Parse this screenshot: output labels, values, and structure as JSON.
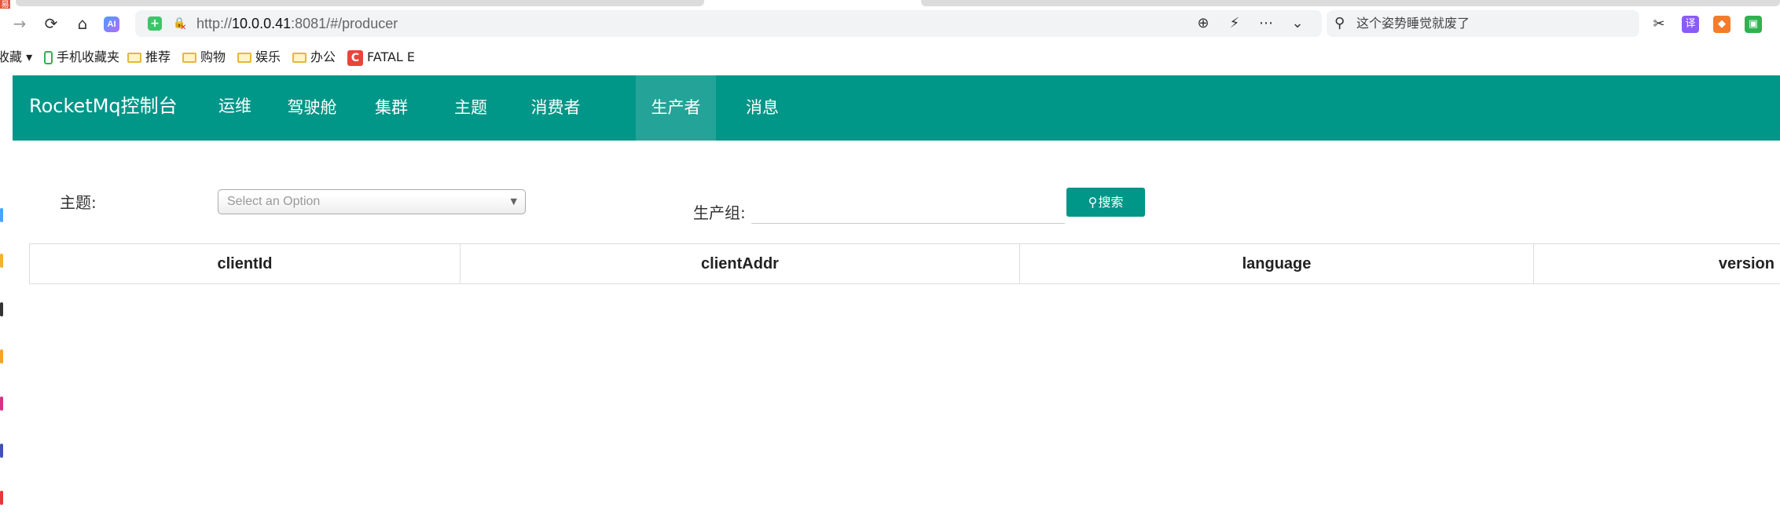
{
  "browser": {
    "corner_badge": "易",
    "url_scheme_host": "http://10.0.0.41",
    "url_host_bold": "10.0.0.41",
    "url_rest": ":8081/#/producer",
    "url_prefix": "http://",
    "search_query": "这个姿势睡觉就废了",
    "ai_label": "AI",
    "bookmarks": {
      "partial_first": "收藏",
      "items": [
        {
          "label": "手机收藏夹",
          "icon": "phone-icon"
        },
        {
          "label": "推荐",
          "icon": "folder-icon"
        },
        {
          "label": "购物",
          "icon": "folder-icon"
        },
        {
          "label": "娱乐",
          "icon": "folder-icon"
        },
        {
          "label": "办公",
          "icon": "folder-icon"
        },
        {
          "label": "FATAL E",
          "icon": "c-badge-icon"
        }
      ]
    }
  },
  "app": {
    "brand": "RocketMq控制台",
    "nav": [
      {
        "label": "运维",
        "active": false
      },
      {
        "label": "驾驶舱",
        "active": false
      },
      {
        "label": "集群",
        "active": false
      },
      {
        "label": "主题",
        "active": false
      },
      {
        "label": "消费者",
        "active": false
      },
      {
        "label": "生产者",
        "active": true
      },
      {
        "label": "消息",
        "active": false
      }
    ],
    "filters": {
      "topic_label": "主题:",
      "topic_placeholder": "Select an Option",
      "group_label": "生产组:",
      "group_value": "",
      "search_button": "搜索"
    },
    "table": {
      "headers": [
        "clientId",
        "clientAddr",
        "language",
        "version"
      ],
      "rows": []
    }
  },
  "colors": {
    "primary": "#009688",
    "text": "#333333",
    "border": "#dddddd"
  }
}
